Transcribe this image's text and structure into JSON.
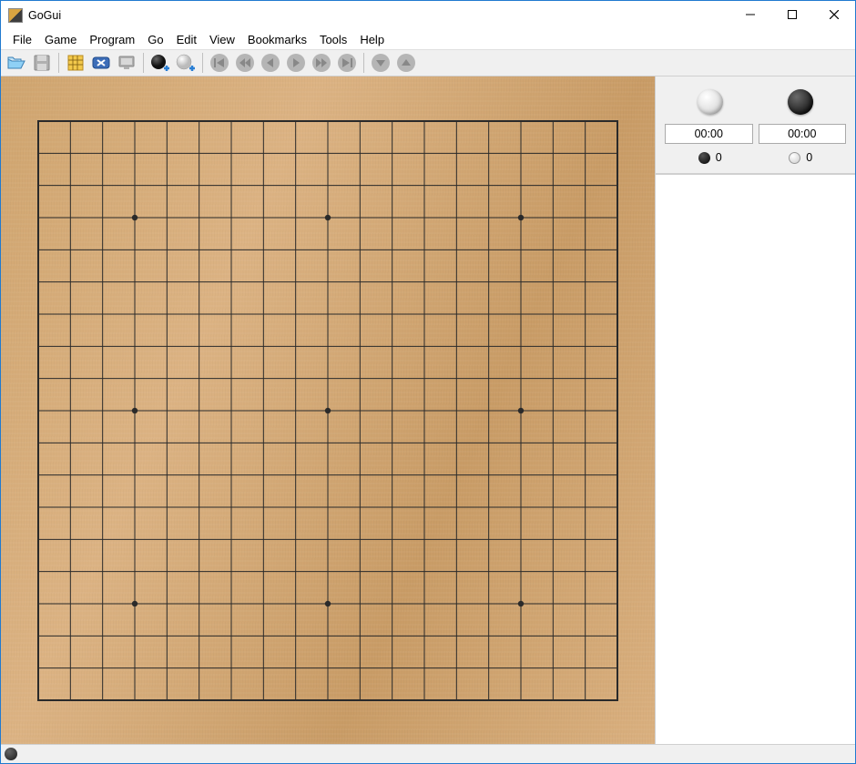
{
  "window": {
    "title": "GoGui"
  },
  "menu": {
    "items": [
      "File",
      "Game",
      "Program",
      "Go",
      "Edit",
      "View",
      "Bookmarks",
      "Tools",
      "Help"
    ]
  },
  "toolbar": {
    "groups": [
      [
        "open",
        "save"
      ],
      [
        "new-game",
        "delete"
      ],
      [
        "attach-program"
      ],
      [
        "play-black",
        "play-white"
      ],
      [
        "nav-first",
        "nav-prev10",
        "nav-prev",
        "nav-next",
        "nav-next10",
        "nav-last"
      ],
      [
        "nav-down",
        "nav-up"
      ]
    ]
  },
  "board": {
    "size": 19,
    "star_points": [
      [
        3,
        3
      ],
      [
        3,
        9
      ],
      [
        3,
        15
      ],
      [
        9,
        3
      ],
      [
        9,
        9
      ],
      [
        9,
        15
      ],
      [
        15,
        3
      ],
      [
        15,
        9
      ],
      [
        15,
        15
      ]
    ]
  },
  "info": {
    "white": {
      "clock": "00:00",
      "captures": "0"
    },
    "black": {
      "clock": "00:00",
      "captures": "0"
    }
  },
  "status": {
    "to_move": "black"
  }
}
